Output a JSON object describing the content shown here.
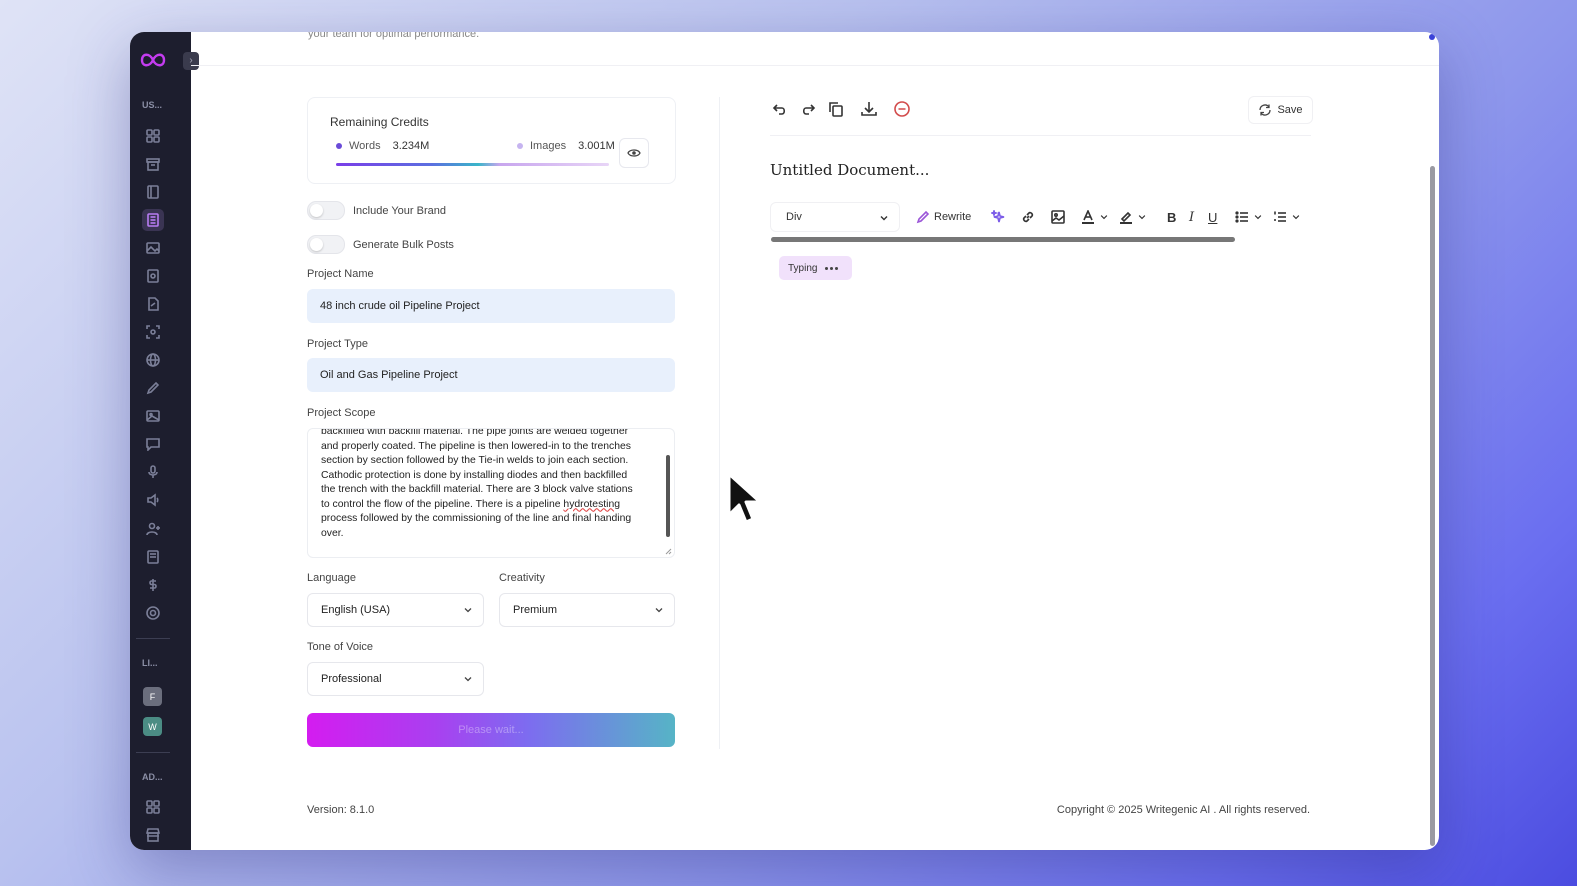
{
  "top_text": "your team for optimal performance.",
  "sidebar": {
    "section_user": "US...",
    "section_links": "LI...",
    "section_admin": "AD...",
    "avatars": [
      {
        "letter": "F",
        "color": "#6b6e7d"
      },
      {
        "letter": "W",
        "color": "#4b8c84"
      }
    ],
    "accent_color": "#b77cf2"
  },
  "credits": {
    "title": "Remaining Credits",
    "words_label": "Words",
    "words_value": "3.234M",
    "words_color": "#6a4bd8",
    "images_label": "Images",
    "images_value": "3.001M",
    "images_color": "#c6b4f0"
  },
  "toggles": {
    "brand_label": "Include Your Brand",
    "bulk_label": "Generate Bulk Posts"
  },
  "form": {
    "project_name_label": "Project Name",
    "project_name_value": "48 inch crude oil Pipeline Project",
    "project_type_label": "Project Type",
    "project_type_value": "Oil and Gas Pipeline Project",
    "project_scope_label": "Project Scope",
    "scope_lines": [
      "backfilled with backfill material. The pipe joints are welded together",
      "and properly coated. The pipeline is then lowered-in to the trenches",
      "section by section followed by the Tie-in welds to join each section.",
      "Cathodic protection is done by installing diodes and then backfilled",
      "the trench with the backfill material. There are 3 block valve stations",
      "to control the flow of the pipeline. There is a pipeline",
      "hydrotesting",
      "process followed by the commissioning of the line and final handing",
      "over."
    ],
    "language_label": "Language",
    "language_value": "English (USA)",
    "creativity_label": "Creativity",
    "creativity_value": "Premium",
    "tone_label": "Tone of Voice",
    "tone_value": "Professional",
    "submit_label": "Please wait..."
  },
  "editor": {
    "save_label": "Save",
    "doc_title": "Untitled Document...",
    "block_type": "Div",
    "rewrite_label": "Rewrite",
    "typing_label": "Typing"
  },
  "footer": {
    "version": "Version: 8.1.0",
    "copyright": "Copyright © 2025 Writegenic AI . All rights reserved."
  }
}
